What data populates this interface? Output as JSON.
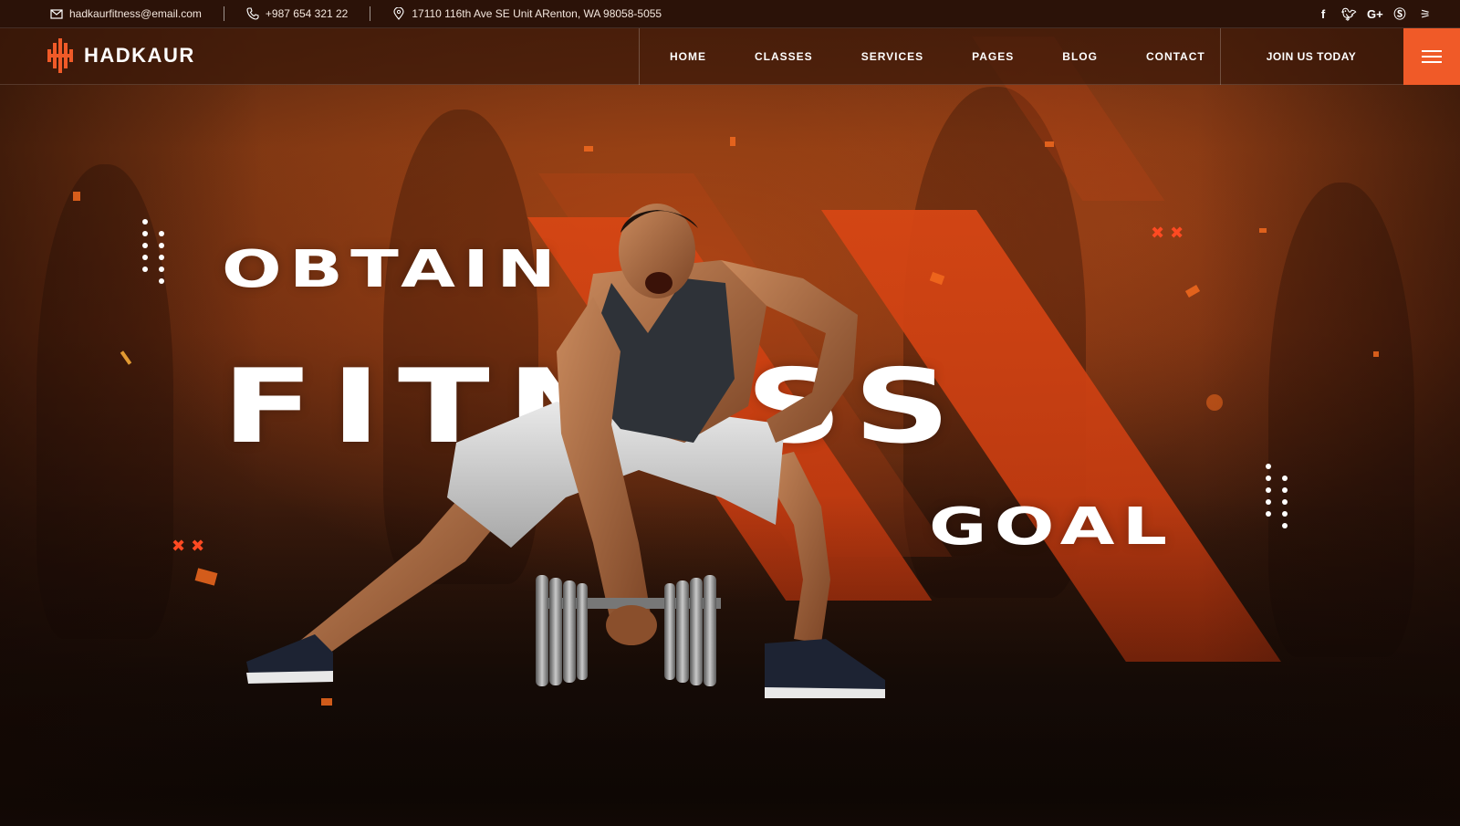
{
  "topbar": {
    "email": "hadkaurfitness@email.com",
    "phone": "+987 654 321 22",
    "address": "17110 116th Ave SE Unit ARenton, WA 98058-5055",
    "social": [
      "facebook-icon",
      "twitter-icon",
      "google-plus-icon",
      "skype-icon",
      "rss-icon"
    ]
  },
  "nav": {
    "logo": "HADKAUR",
    "items": [
      "HOME",
      "CLASSES",
      "SERVICES",
      "PAGES",
      "BLOG",
      "CONTACT"
    ],
    "cta": "JOIN US TODAY",
    "menu_icon": "hamburger-icon"
  },
  "hero": {
    "line1": "OBTAIN",
    "line2": "FITNESS",
    "line3": "GOAL"
  },
  "colors": {
    "accent": "#f05a28",
    "background": "#5a2810",
    "text": "#ffffff"
  }
}
